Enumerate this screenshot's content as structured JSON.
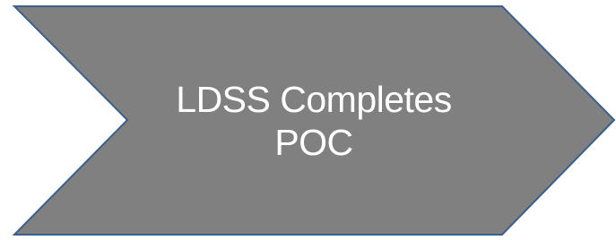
{
  "chevron": {
    "line1": "LDSS Completes",
    "line2": "POC",
    "fill_color": "#808080",
    "stroke_color": "#3b5f8c",
    "text_color": "#ffffff"
  }
}
